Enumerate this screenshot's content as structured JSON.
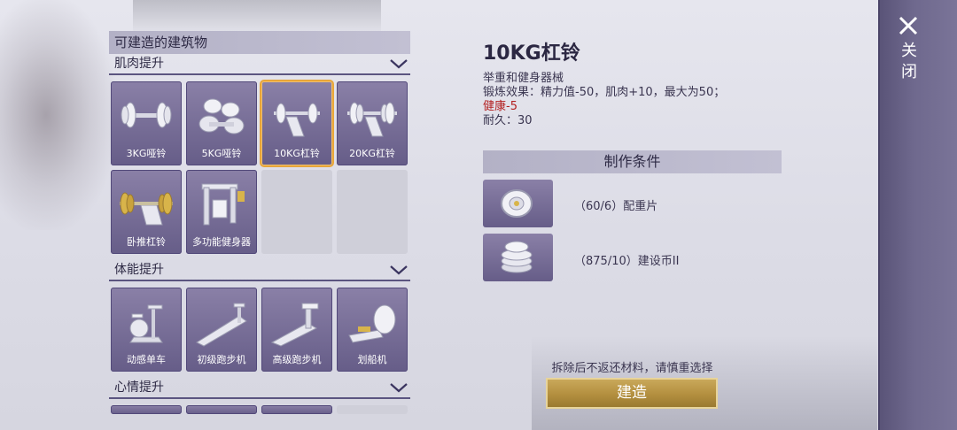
{
  "left_panel": {
    "title": "可建造的建筑物",
    "categories": [
      {
        "name": "肌肉提升",
        "items": [
          {
            "label": "3KG哑铃",
            "icon": "dumbbell-icon"
          },
          {
            "label": "5KG哑铃",
            "icon": "dumbbell-heavy-icon"
          },
          {
            "label": "10KG杠铃",
            "icon": "barbell-rack-icon",
            "selected": true
          },
          {
            "label": "20KG杠铃",
            "icon": "barbell-rack-icon"
          },
          {
            "label": "卧推杠铃",
            "icon": "bench-press-icon"
          },
          {
            "label": "多功能健身器",
            "icon": "multi-gym-icon"
          }
        ]
      },
      {
        "name": "体能提升",
        "items": [
          {
            "label": "动感单车",
            "icon": "exercise-bike-icon"
          },
          {
            "label": "初级跑步机",
            "icon": "treadmill-icon"
          },
          {
            "label": "高级跑步机",
            "icon": "treadmill-icon"
          },
          {
            "label": "划船机",
            "icon": "rowing-machine-icon"
          }
        ]
      },
      {
        "name": "心情提升",
        "items": []
      }
    ]
  },
  "detail": {
    "title": "10KG杠铃",
    "category": "举重和健身器械",
    "effect": "锻炼效果：精力值-50，肌肉+10，最大为50；",
    "health": "健康-5",
    "durability": "耐久：30"
  },
  "requirements": {
    "title": "制作条件",
    "items": [
      {
        "text": "（60/6）配重片",
        "icon": "weight-plate-icon"
      },
      {
        "text": "（875/10）建设币II",
        "icon": "coin-stack-icon"
      }
    ]
  },
  "warning": "拆除后不返还材料，请慎重选择",
  "build_button": "建造",
  "close_label": "关闭",
  "colors": {
    "tile": "#7a7099",
    "selected_border": "#e8a63a",
    "build_button": "#b38f3f",
    "health_text": "#b32020"
  }
}
